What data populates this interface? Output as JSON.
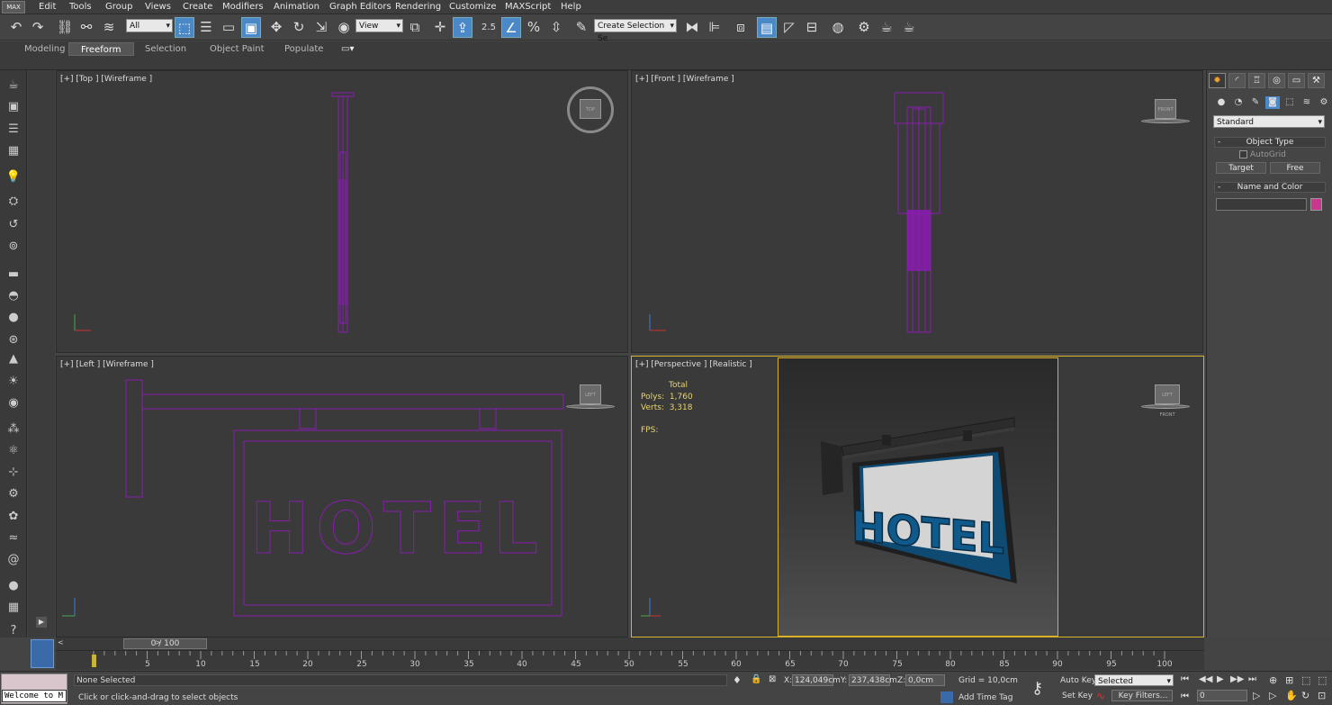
{
  "menu": {
    "logo": "MAX",
    "items": [
      "Edit",
      "Tools",
      "Group",
      "Views",
      "Create",
      "Modifiers",
      "Animation",
      "Graph Editors",
      "Rendering",
      "Customize",
      "MAXScript",
      "Help"
    ]
  },
  "toolbar": {
    "filter_value": "All",
    "ref_coord_value": "View",
    "snap_angle": "2.5",
    "selection_set_placeholder": "Create Selection Se"
  },
  "ribbon": {
    "tabs": [
      "Modeling",
      "Freeform",
      "Selection",
      "Object Paint",
      "Populate"
    ],
    "active_tab": "Freeform"
  },
  "viewports": {
    "top": {
      "label": "[+] [Top ] [Wireframe ]",
      "cube_label": "TOP"
    },
    "front": {
      "label": "[+] [Front ] [Wireframe ]",
      "cube_label": "FRONT"
    },
    "left": {
      "label": "[+] [Left ] [Wireframe ]",
      "cube_label": "LEFT",
      "wire_text": "HOTEL"
    },
    "perspective": {
      "label": "[+] [Perspective ] [Realistic ]",
      "stats_header": "Total",
      "polys_label": "Polys:",
      "polys_value": "1,760",
      "verts_label": "Verts:",
      "verts_value": "3,318",
      "fps_label": "FPS:",
      "sign_text": "HOTEL",
      "cube_label": "LEFT FRONT"
    }
  },
  "command_panel": {
    "dropdown": "Standard",
    "object_type_title": "Object Type",
    "autogrid_label": "AutoGrid",
    "target_button": "Target",
    "free_button": "Free",
    "name_color_title": "Name and Color",
    "name_value": "",
    "object_color": "#c9378e"
  },
  "timeline": {
    "slider_label": "0 / 100",
    "ticks": [
      "5",
      "10",
      "15",
      "20",
      "25",
      "30",
      "35",
      "40",
      "45",
      "50",
      "55",
      "60",
      "65",
      "70",
      "75",
      "80",
      "85",
      "90",
      "95",
      "100"
    ]
  },
  "status": {
    "selection_text": "None Selected",
    "prompt_text": "Click or click-and-drag to select objects",
    "x_label": "X:",
    "x_value": "124,049cm",
    "y_label": "Y:",
    "y_value": "237,438cm",
    "z_label": "Z:",
    "z_value": "0,0cm",
    "grid_text": "Grid = 10,0cm",
    "add_time_tag": "Add Time Tag",
    "auto_key": "Auto Key",
    "set_key": "Set Key",
    "key_mode_value": "Selected",
    "key_filters": "Key Filters...",
    "frame_value": "0",
    "welcome_text": "Welcome to M"
  },
  "colors": {
    "wire": "#8a1cb0",
    "active_border": "#d8b228",
    "accent": "#4a88c8",
    "stats": "#e9d46e"
  }
}
